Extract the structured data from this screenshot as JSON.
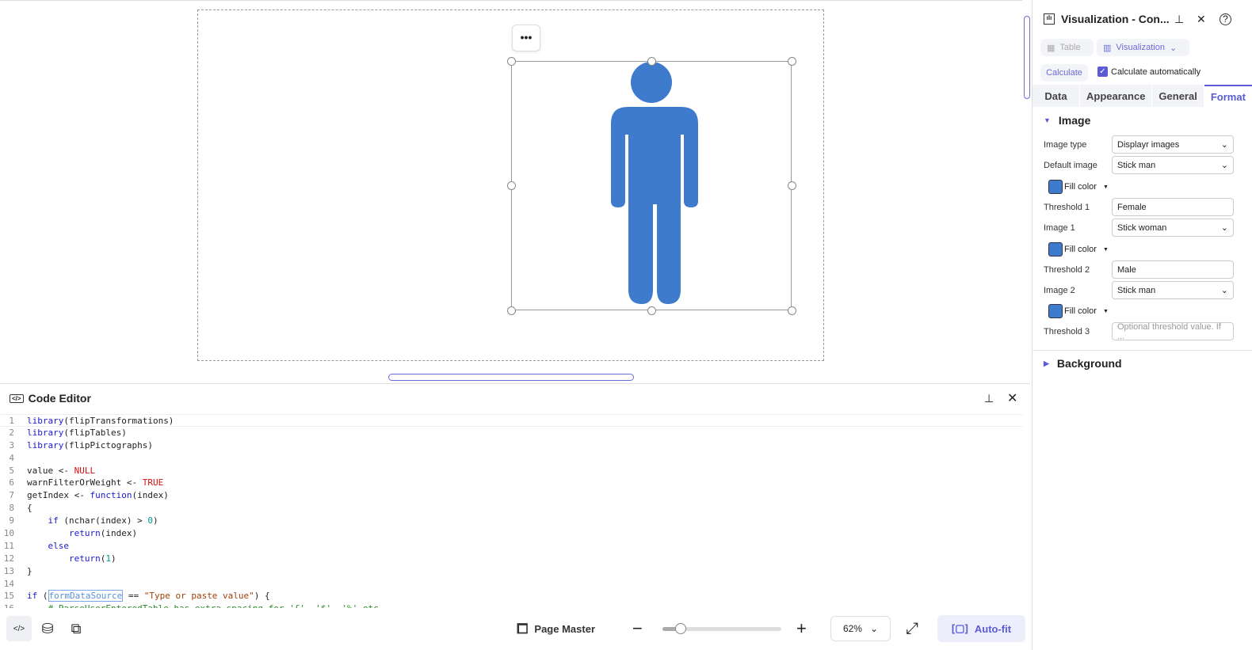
{
  "canvas": {
    "more_label": "•••",
    "figure_color": "#3e7bcc"
  },
  "editor": {
    "title": "Code Editor",
    "lines": [
      [
        {
          "t": "library",
          "c": "kw"
        },
        {
          "t": "(flipTransformations)"
        }
      ],
      [
        {
          "t": "library",
          "c": "kw"
        },
        {
          "t": "(flipTables)"
        }
      ],
      [
        {
          "t": "library",
          "c": "kw"
        },
        {
          "t": "(flipPictographs)"
        }
      ],
      [],
      [
        {
          "t": "value <- "
        },
        {
          "t": "NULL",
          "c": "lit"
        }
      ],
      [
        {
          "t": "warnFilterOrWeight <- "
        },
        {
          "t": "TRUE",
          "c": "lit"
        }
      ],
      [
        {
          "t": "getIndex <- "
        },
        {
          "t": "function",
          "c": "kw"
        },
        {
          "t": "(index)"
        }
      ],
      [
        {
          "t": "{"
        }
      ],
      [
        {
          "t": "    "
        },
        {
          "t": "if",
          "c": "kw"
        },
        {
          "t": " (nchar(index) > "
        },
        {
          "t": "0",
          "c": "n"
        },
        {
          "t": ")"
        }
      ],
      [
        {
          "t": "        "
        },
        {
          "t": "return",
          "c": "kw"
        },
        {
          "t": "(index)"
        }
      ],
      [
        {
          "t": "    "
        },
        {
          "t": "else",
          "c": "kw"
        }
      ],
      [
        {
          "t": "        "
        },
        {
          "t": "return",
          "c": "kw"
        },
        {
          "t": "("
        },
        {
          "t": "1",
          "c": "n"
        },
        {
          "t": ")"
        }
      ],
      [
        {
          "t": "}"
        }
      ],
      [],
      [
        {
          "t": "if",
          "c": "kw"
        },
        {
          "t": " ("
        },
        {
          "t": "formDataSource",
          "c": "hl"
        },
        {
          "t": " == "
        },
        {
          "t": "\"Type or paste value\"",
          "c": "str"
        },
        {
          "t": ") {"
        }
      ],
      [
        {
          "t": "    # ParseUserEnteredTable has extra spacing for '£', '$', '%' etc",
          "c": "cm"
        }
      ]
    ]
  },
  "footer": {
    "page_master": "Page Master",
    "zoom": "62%",
    "zoom_fraction": 0.15,
    "autofit": "Auto-fit"
  },
  "panel": {
    "title": "Visualization - Con...",
    "table_btn": "Table",
    "viz_btn": "Visualization",
    "calculate": "Calculate",
    "calc_auto": "Calculate automatically",
    "calc_auto_checked": true,
    "tabs": [
      "Data",
      "Appearance",
      "General",
      "Format"
    ],
    "active_tab": "Format",
    "section_image": "Image",
    "section_background": "Background",
    "image_type_label": "Image type",
    "image_type": "Displayr images",
    "default_image_label": "Default image",
    "default_image": "Stick man",
    "fill_color": "Fill color",
    "threshold1_label": "Threshold 1",
    "threshold1": "Female",
    "image1_label": "Image 1",
    "image1": "Stick woman",
    "threshold2_label": "Threshold 2",
    "threshold2": "Male",
    "image2_label": "Image 2",
    "image2": "Stick man",
    "threshold3_label": "Threshold 3",
    "threshold3_placeholder": "Optional threshold value. If ..."
  }
}
